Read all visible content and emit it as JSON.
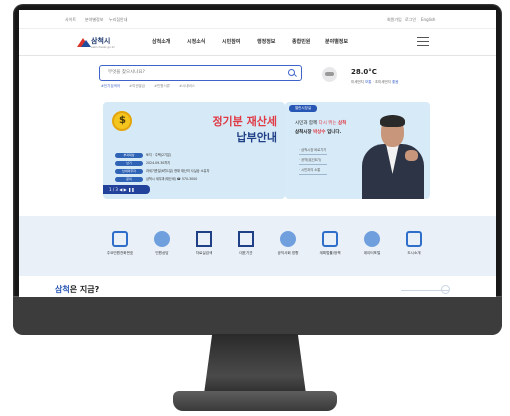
{
  "util": {
    "left": [
      "사이트",
      "분야별정보",
      "누리집안내"
    ],
    "right": [
      "회원가입",
      "로그인",
      "English"
    ]
  },
  "header": {
    "logo_name": "삼척시",
    "logo_sub": "samcheok.go.kr",
    "nav": [
      "삼척소개",
      "시정소식",
      "시민참여",
      "행정정보",
      "종합민원",
      "분야별정보"
    ]
  },
  "search": {
    "placeholder": "무엇을 찾으시나요?",
    "tags": [
      "#인기검색어",
      "#여권발급",
      "#민원서류",
      "#시내버스"
    ]
  },
  "weather": {
    "temp": "28.0°C",
    "sub_prefix": "미세먼지",
    "sub_good": "보통",
    "sub_mid": "· 초미세먼지",
    "sub_good2": "좋음"
  },
  "banner": {
    "title_line1": "정기분 재산세",
    "title_line2": "납부안내",
    "rows": [
      {
        "label": "부과대상",
        "value": "토지 · 주택(2기분)"
      },
      {
        "label": "납기",
        "value": "2024.09.30까지"
      },
      {
        "label": "납세의무자",
        "value": "과세기준일(6월1일) 현재 재산의 사실상 소유자"
      },
      {
        "label": "문의",
        "value": "삼척시 세무과(재산세) ☎ 570-3000"
      }
    ],
    "pager": "1 / 3  ◀  ▶  ❚❚"
  },
  "mayor": {
    "badge": "열린시장실",
    "line1_a": "시민과 함께",
    "line1_b": "다시 뛰는",
    "line1_c": "삼척",
    "line2_a": "삼척시장",
    "line2_b": "박상수",
    "line2_c": "입니다.",
    "links": [
      "· 삼척시장 바로가기",
      "· 공약(民선8기)",
      "· 시민과의 소통"
    ]
  },
  "quick": [
    {
      "label": "주요민원전화번호",
      "icon": "phone-icon"
    },
    {
      "label": "민원상담",
      "icon": "counsel-icon"
    },
    {
      "label": "자료실검색",
      "icon": "document-icon"
    },
    {
      "label": "대표기관",
      "icon": "building-icon"
    },
    {
      "label": "공직사회 방향",
      "icon": "cycle-icon"
    },
    {
      "label": "계획법률/정책",
      "icon": "law-icon"
    },
    {
      "label": "데이터포털",
      "icon": "chart-icon"
    },
    {
      "label": "도시소개",
      "icon": "map-icon"
    }
  ],
  "now": {
    "brand": "삼척",
    "rest": "은 지금?"
  }
}
